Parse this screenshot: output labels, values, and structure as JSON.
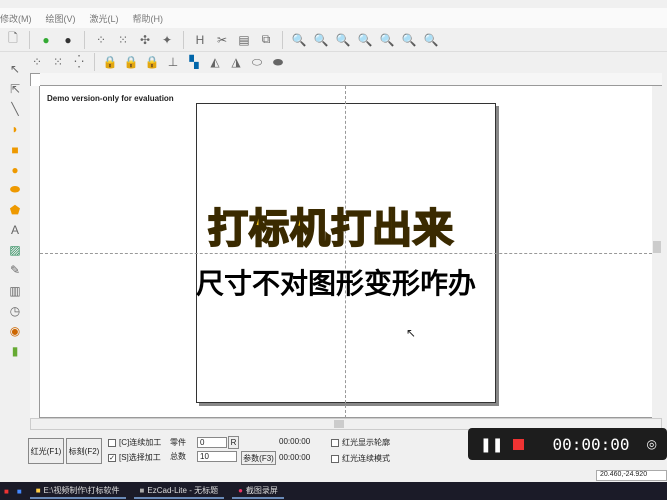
{
  "menu": [
    "修改(M)",
    "绘图(V)",
    "激光(L)",
    "帮助(H)"
  ],
  "canvas": {
    "demo_text": "Demo version-only for evaluation"
  },
  "overlay": {
    "title": "打标机打出来",
    "subtitle": "尺寸不对图形变形咋办"
  },
  "bottom": {
    "red_light": "红光(F1)",
    "mark": "标刻(F2)",
    "continuous": "[C]连续加工",
    "select": "[S]选择加工",
    "select_checked": "✓",
    "part_label": "零件",
    "part_value": "0",
    "reset": "R",
    "total_label": "总数",
    "total_value": "10",
    "params": "参数(F3)",
    "time1": "00:00:00",
    "time2": "00:00:00",
    "red_outline": "红光显示轮廓",
    "red_continuous": "红光连续模式"
  },
  "recorder": {
    "time": "00:00:00"
  },
  "status": {
    "coords": "20.460,-24.920"
  },
  "taskbar": [
    "E:\\视频制作\\打标软件",
    "EzCad-Lite - 无标题",
    "截图录屏"
  ]
}
